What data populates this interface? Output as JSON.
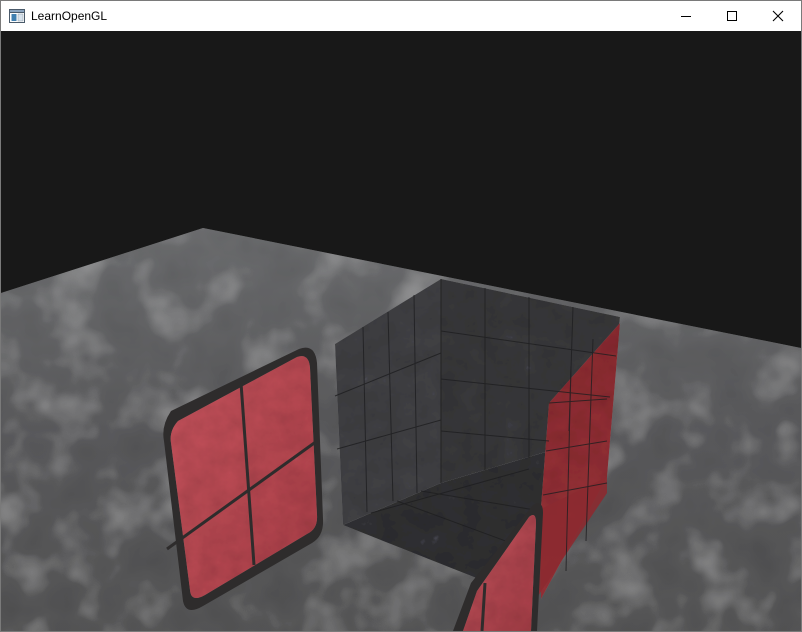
{
  "window": {
    "title": "LearnOpenGL",
    "icon": "app-window-icon",
    "controls": {
      "minimize": "minimize-icon",
      "maximize": "maximize-icon",
      "close": "close-icon"
    }
  },
  "scene": {
    "clear_color": "#181818",
    "floor_color": "#5a5b5d",
    "cube_color": "#3c3c3e",
    "glass_color": "#c0404a",
    "glass_frame_color": "#2e2c2c"
  }
}
